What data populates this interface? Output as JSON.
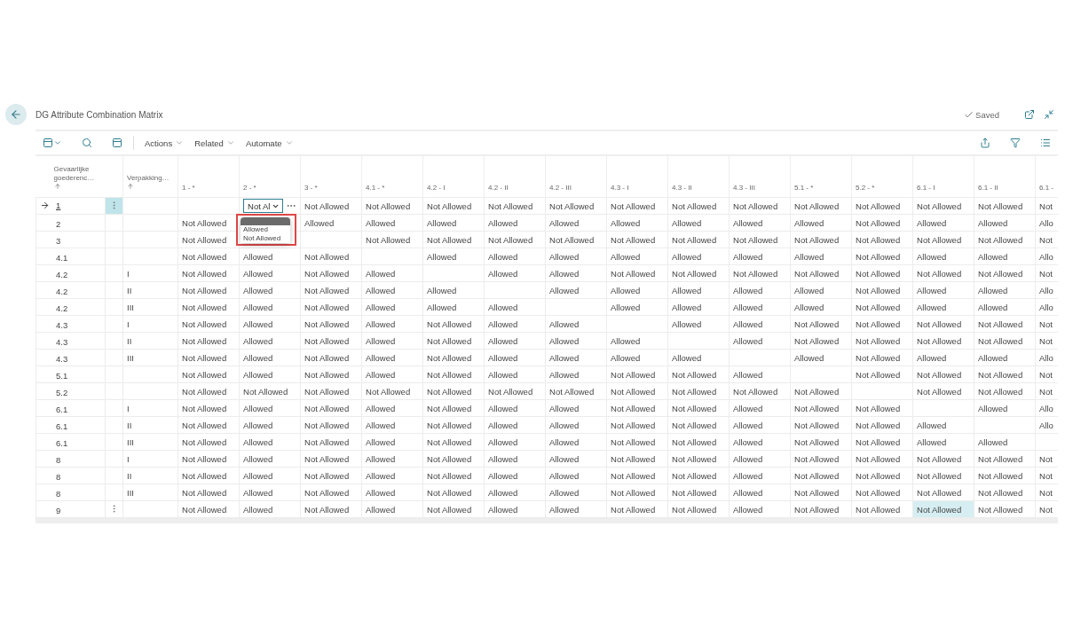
{
  "page": {
    "title": "DG Attribute Combination Matrix",
    "status": "Saved"
  },
  "toolbar": {
    "menus": [
      "Actions",
      "Related",
      "Automate"
    ]
  },
  "table": {
    "columns": [
      {
        "label": "Gevaarlijke goederenc…",
        "sorted": true
      },
      {
        "label": "Verpakking…",
        "sorted": true
      }
    ],
    "matrix_columns": [
      "1 - *",
      "2 - *",
      "3 - *",
      "4.1 - *",
      "4.2 - I",
      "4.2 - II",
      "4.2 - III",
      "4.3 - I",
      "4.3 - II",
      "4.3 - III",
      "5.1 - *",
      "5.2 - *",
      "6.1 - I",
      "6.1 - II",
      "6.1 -"
    ],
    "rows": [
      {
        "code": "1",
        "packing": null,
        "current": true,
        "menu": true,
        "cells": [
          null,
          {
            "kind": "editor",
            "value": "Not Al",
            "annotated": true,
            "options": [
              {
                "label": "Allowed",
                "selected": false
              },
              {
                "label": "Not Allowed",
                "selected": false
              }
            ]
          },
          "Not Allowed",
          "Not Allowed",
          "Not Allowed",
          "Not Allowed",
          "Not Allowed",
          "Not Allowed",
          "Not Allowed",
          "Not Allowed",
          "Not Allowed",
          "Not Allowed",
          "Not Allowed",
          "Not Allowed",
          "Not"
        ]
      },
      {
        "code": "2",
        "packing": null,
        "current": false,
        "menu": false,
        "cells": [
          "Not Allowed",
          null,
          "Allowed",
          "Allowed",
          "Allowed",
          "Allowed",
          "Allowed",
          "Allowed",
          "Allowed",
          "Allowed",
          "Allowed",
          "Not Allowed",
          "Allowed",
          "Allowed",
          "Allo"
        ]
      },
      {
        "code": "3",
        "packing": null,
        "current": false,
        "menu": false,
        "cells": [
          "Not Allowed",
          null,
          null,
          "Not Allowed",
          "Not Allowed",
          "Not Allowed",
          "Not Allowed",
          "Not Allowed",
          "Not Allowed",
          "Not Allowed",
          "Not Allowed",
          "Not Allowed",
          "Not Allowed",
          "Not Allowed",
          "Not"
        ]
      },
      {
        "code": "4.1",
        "packing": null,
        "current": false,
        "menu": false,
        "cells": [
          "Not Allowed",
          "Allowed",
          "Not Allowed",
          null,
          "Allowed",
          "Allowed",
          "Allowed",
          "Allowed",
          "Allowed",
          "Allowed",
          "Allowed",
          "Not Allowed",
          "Allowed",
          "Allowed",
          "Allo"
        ]
      },
      {
        "code": "4.2",
        "packing": "I",
        "current": false,
        "menu": false,
        "cells": [
          "Not Allowed",
          "Allowed",
          "Not Allowed",
          "Allowed",
          null,
          "Allowed",
          "Allowed",
          "Not Allowed",
          "Not Allowed",
          "Not Allowed",
          "Not Allowed",
          "Not Allowed",
          "Not Allowed",
          "Not Allowed",
          "Not"
        ]
      },
      {
        "code": "4.2",
        "packing": "II",
        "current": false,
        "menu": false,
        "cells": [
          "Not Allowed",
          "Allowed",
          "Not Allowed",
          "Allowed",
          "Allowed",
          null,
          "Allowed",
          "Allowed",
          "Allowed",
          "Allowed",
          "Allowed",
          "Not Allowed",
          "Allowed",
          "Allowed",
          "Allo"
        ]
      },
      {
        "code": "4.2",
        "packing": "III",
        "current": false,
        "menu": false,
        "cells": [
          "Not Allowed",
          "Allowed",
          "Not Allowed",
          "Allowed",
          "Allowed",
          "Allowed",
          null,
          "Allowed",
          "Allowed",
          "Allowed",
          "Allowed",
          "Not Allowed",
          "Allowed",
          "Allowed",
          "Allo"
        ]
      },
      {
        "code": "4.3",
        "packing": "I",
        "current": false,
        "menu": false,
        "cells": [
          "Not Allowed",
          "Allowed",
          "Not Allowed",
          "Allowed",
          "Not Allowed",
          "Allowed",
          "Allowed",
          null,
          "Allowed",
          "Allowed",
          "Not Allowed",
          "Not Allowed",
          "Not Allowed",
          "Not Allowed",
          "Not"
        ]
      },
      {
        "code": "4.3",
        "packing": "II",
        "current": false,
        "menu": false,
        "cells": [
          "Not Allowed",
          "Allowed",
          "Not Allowed",
          "Allowed",
          "Not Allowed",
          "Allowed",
          "Allowed",
          "Allowed",
          null,
          "Allowed",
          "Not Allowed",
          "Not Allowed",
          "Not Allowed",
          "Not Allowed",
          "Not"
        ]
      },
      {
        "code": "4.3",
        "packing": "III",
        "current": false,
        "menu": false,
        "cells": [
          "Not Allowed",
          "Allowed",
          "Not Allowed",
          "Allowed",
          "Not Allowed",
          "Allowed",
          "Allowed",
          "Allowed",
          "Allowed",
          null,
          "Allowed",
          "Not Allowed",
          "Allowed",
          "Allowed",
          "Allo"
        ]
      },
      {
        "code": "5.1",
        "packing": null,
        "current": false,
        "menu": false,
        "cells": [
          "Not Allowed",
          "Allowed",
          "Not Allowed",
          "Allowed",
          "Not Allowed",
          "Allowed",
          "Allowed",
          "Not Allowed",
          "Not Allowed",
          "Allowed",
          null,
          "Not Allowed",
          "Not Allowed",
          "Not Allowed",
          "Not"
        ]
      },
      {
        "code": "5.2",
        "packing": null,
        "current": false,
        "menu": false,
        "cells": [
          "Not Allowed",
          "Not Allowed",
          "Not Allowed",
          "Not Allowed",
          "Not Allowed",
          "Not Allowed",
          "Not Allowed",
          "Not Allowed",
          "Not Allowed",
          "Not Allowed",
          "Not Allowed",
          null,
          "Not Allowed",
          "Not Allowed",
          "Not"
        ]
      },
      {
        "code": "6.1",
        "packing": "I",
        "current": false,
        "menu": false,
        "cells": [
          "Not Allowed",
          "Allowed",
          "Not Allowed",
          "Allowed",
          "Not Allowed",
          "Allowed",
          "Allowed",
          "Not Allowed",
          "Not Allowed",
          "Allowed",
          "Not Allowed",
          "Not Allowed",
          null,
          "Allowed",
          "Allo"
        ]
      },
      {
        "code": "6.1",
        "packing": "II",
        "current": false,
        "menu": false,
        "cells": [
          "Not Allowed",
          "Allowed",
          "Not Allowed",
          "Allowed",
          "Not Allowed",
          "Allowed",
          "Allowed",
          "Not Allowed",
          "Not Allowed",
          "Allowed",
          "Not Allowed",
          "Not Allowed",
          "Allowed",
          null,
          "Allo"
        ]
      },
      {
        "code": "6.1",
        "packing": "III",
        "current": false,
        "menu": false,
        "cells": [
          "Not Allowed",
          "Allowed",
          "Not Allowed",
          "Allowed",
          "Not Allowed",
          "Allowed",
          "Allowed",
          "Not Allowed",
          "Not Allowed",
          "Allowed",
          "Not Allowed",
          "Not Allowed",
          "Allowed",
          "Allowed",
          null
        ]
      },
      {
        "code": "8",
        "packing": "I",
        "current": false,
        "menu": false,
        "cells": [
          "Not Allowed",
          "Allowed",
          "Not Allowed",
          "Allowed",
          "Not Allowed",
          "Allowed",
          "Allowed",
          "Not Allowed",
          "Not Allowed",
          "Allowed",
          "Not Allowed",
          "Not Allowed",
          "Not Allowed",
          "Not Allowed",
          "Not"
        ]
      },
      {
        "code": "8",
        "packing": "II",
        "current": false,
        "menu": false,
        "cells": [
          "Not Allowed",
          "Allowed",
          "Not Allowed",
          "Allowed",
          "Not Allowed",
          "Allowed",
          "Allowed",
          "Not Allowed",
          "Not Allowed",
          "Allowed",
          "Not Allowed",
          "Not Allowed",
          "Not Allowed",
          "Not Allowed",
          "Not"
        ]
      },
      {
        "code": "8",
        "packing": "III",
        "current": false,
        "menu": false,
        "cells": [
          "Not Allowed",
          "Allowed",
          "Not Allowed",
          "Allowed",
          "Not Allowed",
          "Allowed",
          "Allowed",
          "Not Allowed",
          "Not Allowed",
          "Allowed",
          "Not Allowed",
          "Not Allowed",
          "Not Allowed",
          "Not Allowed",
          "Not"
        ]
      },
      {
        "code": "9",
        "packing": null,
        "current": false,
        "menu": true,
        "cells": [
          "Not Allowed",
          "Allowed",
          "Not Allowed",
          "Allowed",
          "Not Allowed",
          "Allowed",
          "Allowed",
          "Not Allowed",
          "Not Allowed",
          "Allowed",
          "Not Allowed",
          "Not Allowed",
          {
            "value": "Not Allowed",
            "selected": true
          },
          "Not Allowed",
          "Not"
        ]
      }
    ]
  }
}
